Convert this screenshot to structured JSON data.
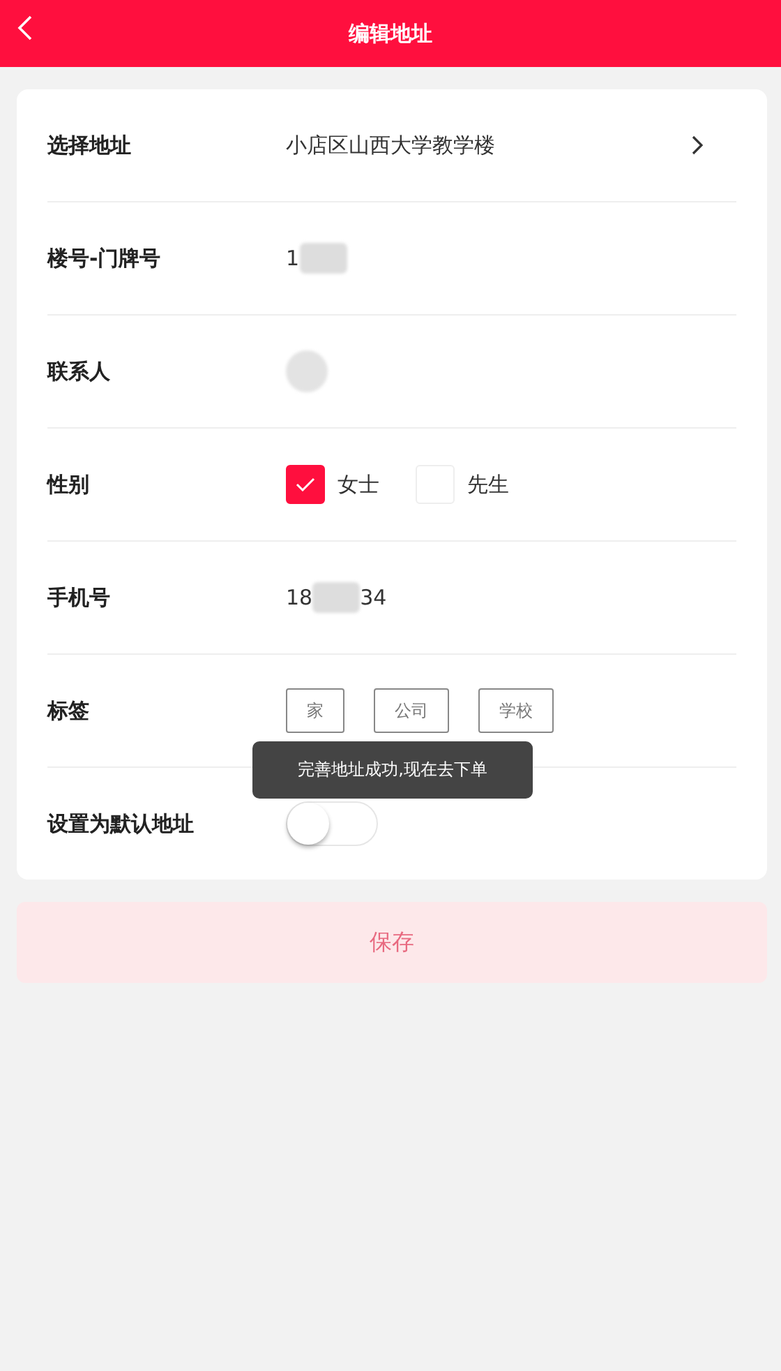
{
  "header": {
    "title": "编辑地址"
  },
  "form": [
    {
      "kind": "link",
      "label": "选择地址",
      "value": "小店区山西大学教学楼"
    },
    {
      "kind": "redacted",
      "label": "楼号-门牌号",
      "before": "1"
    },
    {
      "kind": "redacted",
      "label": "联系人"
    },
    {
      "kind": "choice",
      "label": "性别",
      "options": [
        {
          "label": "女士",
          "selected": true
        },
        {
          "label": "先生",
          "selected": false
        }
      ]
    },
    {
      "kind": "redacted",
      "label": "手机号",
      "before": "18",
      "after": "34"
    },
    {
      "kind": "tags",
      "label": "标签",
      "tags": [
        {
          "label": "家",
          "selected": false
        },
        {
          "label": "公司",
          "selected": false
        },
        {
          "label": "学校",
          "selected": false
        }
      ]
    },
    {
      "kind": "switch",
      "label": "设置为默认地址",
      "on": false
    }
  ],
  "save_button": {
    "label": "保存",
    "disabled": true
  },
  "toast": {
    "text": "完善地址成功,现在去下单"
  }
}
